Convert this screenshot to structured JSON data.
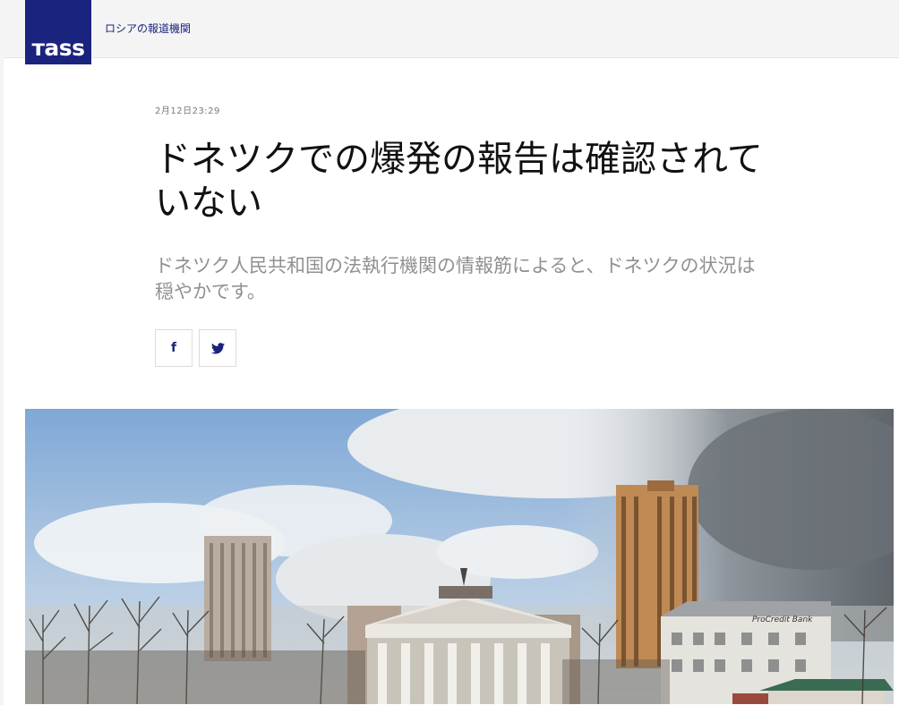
{
  "header": {
    "logo_text": "тass",
    "tagline": "ロシアの報道機関"
  },
  "article": {
    "date": "2月12日23:29",
    "headline": "ドネツクでの爆発の報告は確認されていない",
    "lead": "ドネツク人民共和国の法執行機関の情報筋によると、ドネツクの状況は穏やかです。"
  },
  "share": {
    "facebook_label": "f",
    "twitter_icon": "twitter-bird-icon"
  },
  "photo": {
    "sign_bank": "ProCredit Bank"
  },
  "colors": {
    "brand": "#1a237e",
    "date": "#7a7a7a",
    "lead": "#909090"
  }
}
